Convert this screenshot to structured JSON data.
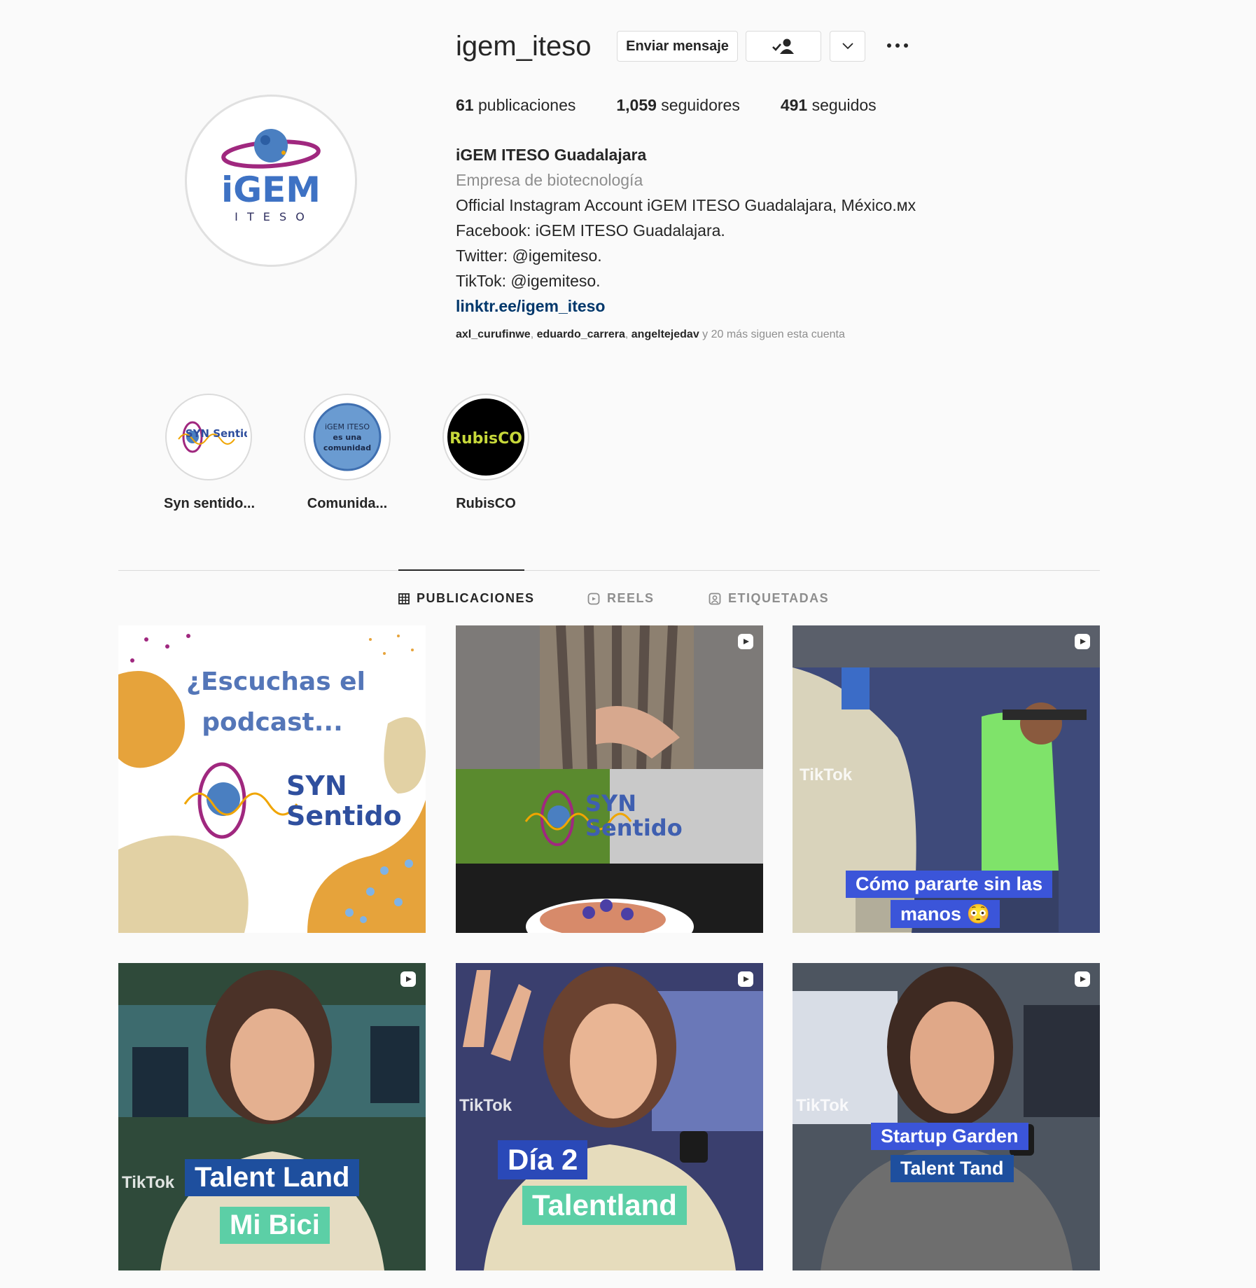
{
  "profile": {
    "username": "igem_iteso",
    "buttons": {
      "message": "Enviar mensaje"
    },
    "stats": [
      {
        "count": "61",
        "label": " publicaciones"
      },
      {
        "count": "1,059",
        "label": " seguidores"
      },
      {
        "count": "491",
        "label": " seguidos"
      }
    ],
    "bio": {
      "name": "iGEM ITESO Guadalajara",
      "category": "Empresa de biotecnología",
      "lines": [
        "Official Instagram Account iGEM ITESO Guadalajara, México.ᴍx",
        "Facebook: iGEM ITESO Guadalajara.",
        "Twitter: @igemiteso.",
        "TikTok: @igemiteso."
      ],
      "link": "linktr.ee/igem_iteso"
    },
    "followed_by": {
      "users": [
        "axl_curufinwe",
        "eduardo_carrera",
        "angeltejedav"
      ],
      "suffix": " y 20 más siguen esta cuenta"
    },
    "avatar_text": {
      "main": "iGEM",
      "sub": "I T E S O"
    }
  },
  "highlights": [
    {
      "label": "Syn sentido...",
      "logo": "SYN Sentido"
    },
    {
      "label": "Comunida...",
      "logo_lines": [
        "iGEM ITESO",
        "es una",
        "comunidad"
      ]
    },
    {
      "label": "RubisCO",
      "logo": "RubisCO"
    }
  ],
  "tabs": [
    {
      "label": "PUBLICACIONES",
      "icon": "grid-icon",
      "active": true
    },
    {
      "label": "REELS",
      "icon": "reels-icon",
      "active": false
    },
    {
      "label": "ETIQUETADAS",
      "icon": "tagged-icon",
      "active": false
    }
  ],
  "posts": [
    {
      "type": "image",
      "text_lines": [
        "¿Escuchas el",
        "podcast..."
      ],
      "logo": [
        "SYN",
        "Sentido"
      ]
    },
    {
      "type": "reel",
      "logo": [
        "SYN",
        "Sentido"
      ]
    },
    {
      "type": "reel",
      "tiktok": "TikTok",
      "captions": [
        "Cómo pararte sin las",
        "manos 😳"
      ]
    },
    {
      "type": "reel",
      "tiktok": "TikTok",
      "captions": [
        "Talent Land",
        "Mi Bici"
      ]
    },
    {
      "type": "reel",
      "tiktok": "TikTok",
      "captions": [
        "Día 2",
        "Talentland"
      ]
    },
    {
      "type": "reel",
      "tiktok": "TikTok",
      "captions": [
        "Startup Garden",
        "Talent Tand"
      ]
    }
  ],
  "colors": {
    "link": "#00376b",
    "muted": "#8e8e8e",
    "brand_purple": "#a0287f",
    "brand_blue": "#4a7fc1",
    "caption_blue": "#3b55d9",
    "caption_mint": "#5ccfa6",
    "caption_navy": "#1e4f9e"
  }
}
